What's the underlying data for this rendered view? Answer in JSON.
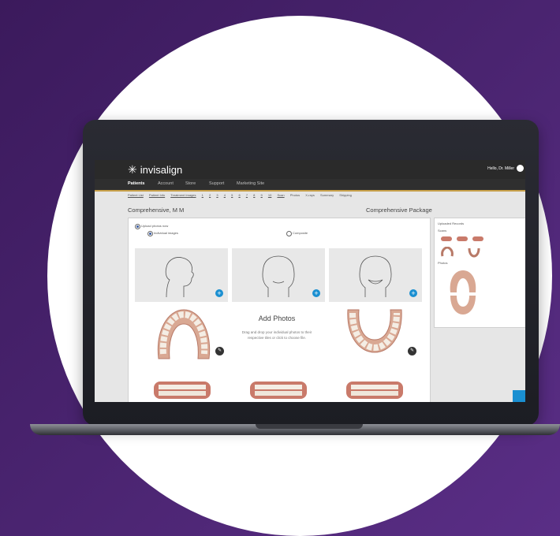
{
  "app": {
    "logo_text": "invisalign",
    "greeting": "Hello, Dr. Miller"
  },
  "nav": {
    "items": [
      "Patients",
      "Account",
      "Store",
      "Support",
      "Marketing Site"
    ],
    "active": "Patients"
  },
  "subnav": {
    "links": [
      "Patient List",
      "Patient Info",
      "Treatment Images",
      "1",
      "2",
      "3",
      "4",
      "5",
      "6",
      "7",
      "8",
      "9",
      "10",
      "Scan",
      "Photos",
      "X-rays",
      "Summary",
      "Shipping"
    ]
  },
  "patient": {
    "name": "Comprehensive, M M",
    "package": "Comprehensive Package"
  },
  "upload": {
    "option_now": "Upload photos now",
    "option_individual": "Individual images",
    "option_composite": "Composite"
  },
  "add_photos": {
    "title": "Add Photos",
    "description": "Drag and drop your individual photos to their respective tiles or click to choose file."
  },
  "uploaded_records": {
    "title": "Uploaded Records",
    "scans_label": "Scans",
    "photos_label": "Photos"
  },
  "icons": {
    "logo": "star-logo-icon",
    "add": "plus-icon",
    "edit": "pencil-icon",
    "user": "user-icon"
  },
  "colors": {
    "background": "#4a2470",
    "header": "#2a2a2a",
    "accent": "#1a8fd1",
    "gold_rule": "#c8a04a"
  }
}
